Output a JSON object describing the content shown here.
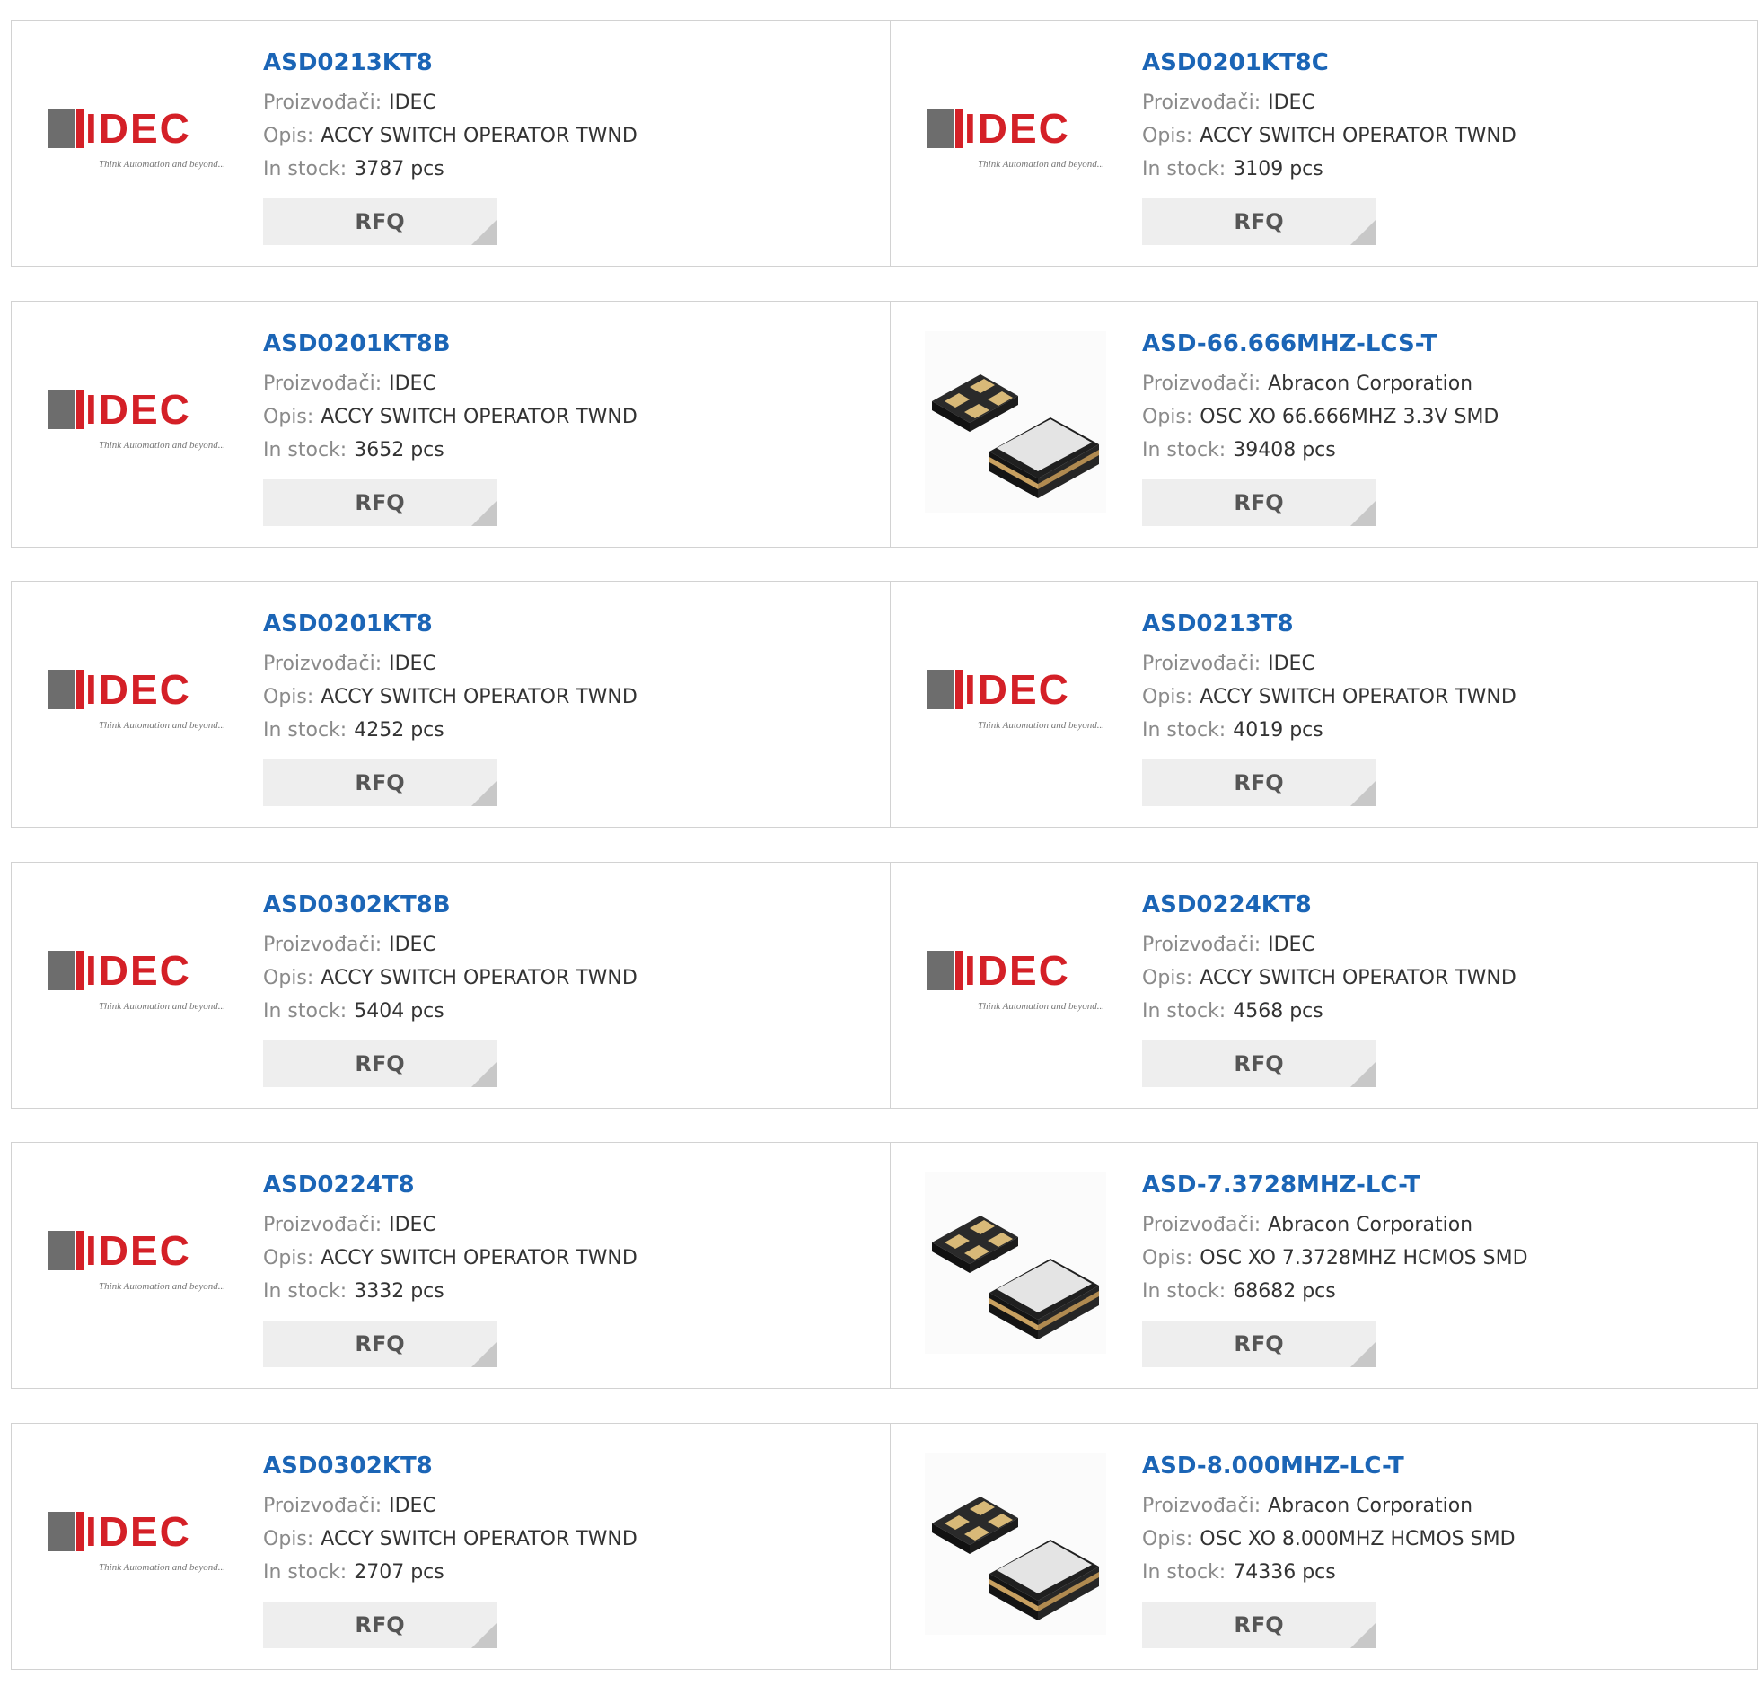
{
  "labels": {
    "manufacturer": "Proizvođači:",
    "description": "Opis:",
    "stock": "In stock:",
    "rfq": "RFQ"
  },
  "logo": {
    "idec_word": "IDEC",
    "idec_tagline": "Think Automation and beyond..."
  },
  "colors": {
    "link": "#1b65b6",
    "label": "#8a8a8a",
    "button_bg": "#eeeeee",
    "border": "#d2d2d2",
    "idec_red": "#d42027"
  },
  "products": [
    {
      "part": "ASD0213KT8",
      "manufacturer": "IDEC",
      "description": "ACCY SWITCH OPERATOR TWND",
      "stock": "3787 pcs",
      "image": "idec-logo"
    },
    {
      "part": "ASD0201KT8C",
      "manufacturer": "IDEC",
      "description": "ACCY SWITCH OPERATOR TWND",
      "stock": "3109 pcs",
      "image": "idec-logo"
    },
    {
      "part": "ASD0201KT8B",
      "manufacturer": "IDEC",
      "description": "ACCY SWITCH OPERATOR TWND",
      "stock": "3652 pcs",
      "image": "idec-logo"
    },
    {
      "part": "ASD-66.666MHZ-LCS-T",
      "manufacturer": "Abracon Corporation",
      "description": "OSC XO 66.666MHZ 3.3V SMD",
      "stock": "39408 pcs",
      "image": "oscillator"
    },
    {
      "part": "ASD0201KT8",
      "manufacturer": "IDEC",
      "description": "ACCY SWITCH OPERATOR TWND",
      "stock": "4252 pcs",
      "image": "idec-logo"
    },
    {
      "part": "ASD0213T8",
      "manufacturer": "IDEC",
      "description": "ACCY SWITCH OPERATOR TWND",
      "stock": "4019 pcs",
      "image": "idec-logo"
    },
    {
      "part": "ASD0302KT8B",
      "manufacturer": "IDEC",
      "description": "ACCY SWITCH OPERATOR TWND",
      "stock": "5404 pcs",
      "image": "idec-logo"
    },
    {
      "part": "ASD0224KT8",
      "manufacturer": "IDEC",
      "description": "ACCY SWITCH OPERATOR TWND",
      "stock": "4568 pcs",
      "image": "idec-logo"
    },
    {
      "part": "ASD0224T8",
      "manufacturer": "IDEC",
      "description": "ACCY SWITCH OPERATOR TWND",
      "stock": "3332 pcs",
      "image": "idec-logo"
    },
    {
      "part": "ASD-7.3728MHZ-LC-T",
      "manufacturer": "Abracon Corporation",
      "description": "OSC XO 7.3728MHZ HCMOS SMD",
      "stock": "68682 pcs",
      "image": "oscillator"
    },
    {
      "part": "ASD0302KT8",
      "manufacturer": "IDEC",
      "description": "ACCY SWITCH OPERATOR TWND",
      "stock": "2707 pcs",
      "image": "idec-logo"
    },
    {
      "part": "ASD-8.000MHZ-LC-T",
      "manufacturer": "Abracon Corporation",
      "description": "OSC XO 8.000MHZ HCMOS SMD",
      "stock": "74336 pcs",
      "image": "oscillator"
    }
  ]
}
